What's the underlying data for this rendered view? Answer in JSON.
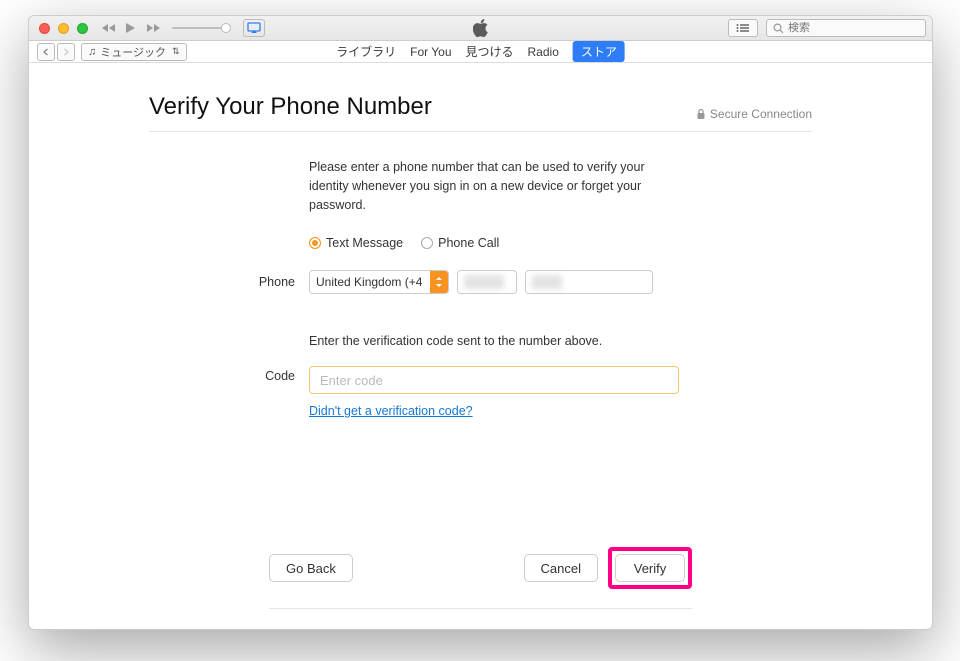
{
  "titlebar": {
    "airplay_icon": "airplay"
  },
  "search": {
    "placeholder": "検索"
  },
  "source_selector": {
    "label": "ミュージック"
  },
  "tabs": {
    "library": "ライブラリ",
    "for_you": "For You",
    "browse": "見つける",
    "radio": "Radio",
    "store": "ストア"
  },
  "page": {
    "title": "Verify Your Phone Number",
    "secure": "Secure Connection",
    "explain": "Please enter a phone number that can be used to verify your identity whenever you sign in on a new device or forget your password.",
    "option_text_message": "Text Message",
    "option_phone_call": "Phone Call",
    "phone_label": "Phone",
    "country": "United Kingdom (+4",
    "code_instructions": "Enter the verification code sent to the number above.",
    "code_label": "Code",
    "code_placeholder": "Enter code",
    "resend_link": "Didn't get a verification code?"
  },
  "footer": {
    "go_back": "Go Back",
    "cancel": "Cancel",
    "verify": "Verify"
  }
}
